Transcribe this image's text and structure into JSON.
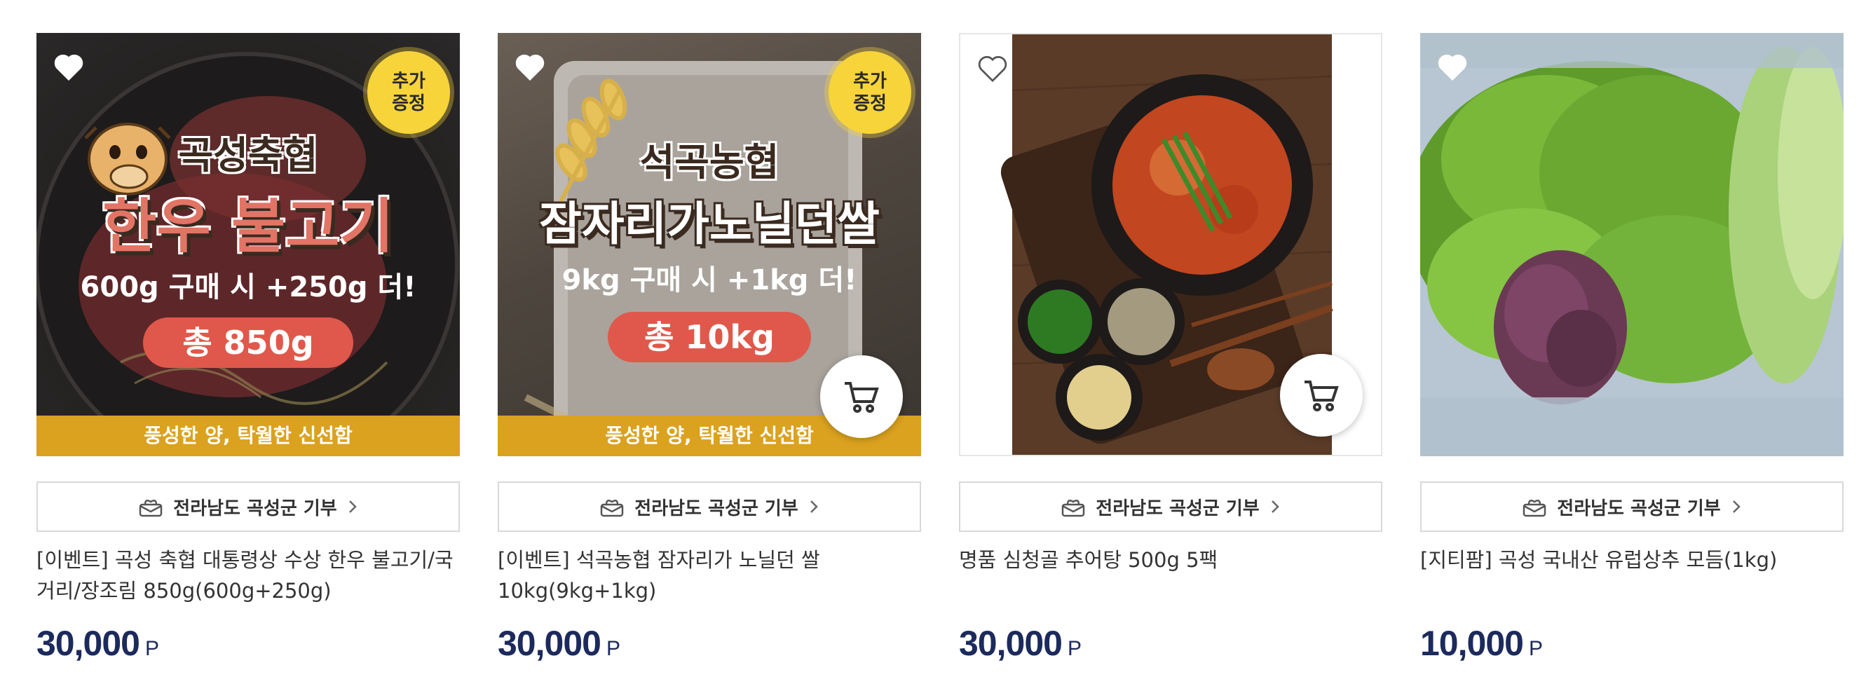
{
  "products": [
    {
      "name": "[이벤트] 곡성 축협 대통령상 수상 한우 불고기/국거리/장조림 850g(600g+250g)",
      "region": "전라남도 곡성군 기부",
      "price": "30,000",
      "currency": "P",
      "promo": {
        "badge_top": "추가",
        "badge_bottom": "증정",
        "title_line1": "곡성축협",
        "title_line2": "한우 불고기",
        "sub": "600g 구매 시 +250g 더!",
        "total": "총 850g",
        "band": "풍성한 양, 탁월한 신선함"
      }
    },
    {
      "name": "[이벤트] 석곡농협 잠자리가 노닐던 쌀 10kg(9kg+1kg)",
      "region": "전라남도 곡성군 기부",
      "price": "30,000",
      "currency": "P",
      "promo": {
        "badge_top": "추가",
        "badge_bottom": "증정",
        "title_line1": "석곡농협",
        "title_line2": "잠자리가노닐던쌀",
        "sub": "9kg 구매 시 +1kg 더!",
        "total": "총 10kg",
        "band": "풍성한 양, 탁월한 신선함"
      }
    },
    {
      "name": "명품 심청골 추어탕 500g 5팩",
      "region": "전라남도 곡성군 기부",
      "price": "30,000",
      "currency": "P"
    },
    {
      "name": "[지티팜] 곡성 국내산 유럽상추 모듬(1kg)",
      "region": "전라남도 곡성군 기부",
      "price": "10,000",
      "currency": "P"
    }
  ],
  "icons": {
    "wishlist": "heart-icon",
    "cart": "cart-icon",
    "region": "gift-box-icon",
    "region_arrow": "chevron-right-icon"
  },
  "colors": {
    "price": "#1c2a5c",
    "band": "#dba21f",
    "total_pill": "#e0584b",
    "badge": "#f7d43a"
  }
}
